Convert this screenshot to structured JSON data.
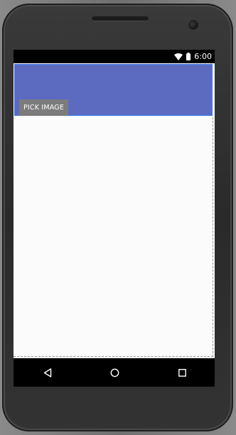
{
  "status_bar": {
    "time": "6:00",
    "icons": [
      "wifi-icon",
      "battery-icon"
    ]
  },
  "header": {
    "color": "#5c6bc0",
    "pick_image_label": "PICK IMAGE"
  },
  "nav_bar": {
    "icons": [
      "back-icon",
      "home-icon",
      "recents-icon"
    ]
  }
}
